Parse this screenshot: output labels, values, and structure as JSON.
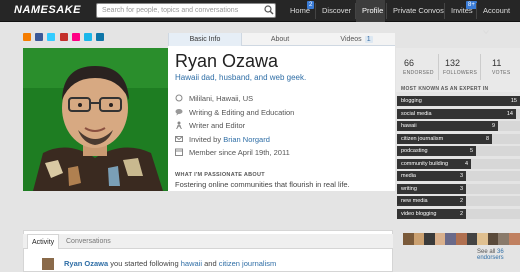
{
  "nav": {
    "logo": "NAMESAKE",
    "search_placeholder": "Search for people, topics and conversations",
    "items": [
      {
        "label": "Home",
        "badge": "2"
      },
      {
        "label": "Discover"
      },
      {
        "label": "Profile"
      },
      {
        "label": "Private Convos"
      },
      {
        "label": "Invites",
        "badge": "8+"
      },
      {
        "label": "Account"
      }
    ]
  },
  "tabs": {
    "basic_info": "Basic Info",
    "about": "About",
    "videos": "Videos",
    "videos_count": "1"
  },
  "profile": {
    "name": "Ryan Ozawa",
    "tagline": "Hawaii dad, husband, and web geek.",
    "location": "Mililani, Hawaii, US",
    "fields": "Writing & Editing and Education",
    "role": "Writer and Editor",
    "invited_prefix": "Invited by",
    "invited_by": "Brian Norgard",
    "member_since": "Member since April 19th, 2011",
    "passion_label": "WHAT I'M PASSIONATE ABOUT",
    "passion": "Fostering online communities that flourish in real life."
  },
  "stats": {
    "endorsed": "66",
    "endorsed_label": "ENDORSED",
    "followers": "132",
    "followers_label": "FOLLOWERS",
    "votes": "11",
    "votes_label": "VOTES"
  },
  "expert": {
    "title": "MOST KNOWN AS AN EXPERT IN",
    "tags": [
      {
        "label": "blogging",
        "count": "15",
        "fraction": 1.0
      },
      {
        "label": "social media",
        "count": "14",
        "fraction": 0.97
      },
      {
        "label": "hawaii",
        "count": "9",
        "fraction": 0.82
      },
      {
        "label": "citizen journalism",
        "count": "8",
        "fraction": 0.77
      },
      {
        "label": "podcasting",
        "count": "5",
        "fraction": 0.64
      },
      {
        "label": "community building",
        "count": "4",
        "fraction": 0.6
      },
      {
        "label": "media",
        "count": "3",
        "fraction": 0.56
      },
      {
        "label": "writing",
        "count": "3",
        "fraction": 0.56
      },
      {
        "label": "new media",
        "count": "2",
        "fraction": 0.56
      },
      {
        "label": "video blogging",
        "count": "2",
        "fraction": 0.56
      }
    ]
  },
  "endorsers": {
    "see_all_prefix": "See all",
    "see_all_link": "36 endorsers"
  },
  "activity": {
    "tab_activity": "Activity",
    "tab_conversations": "Conversations",
    "user": "Ryan Ozawa",
    "text1": "you started following",
    "topic1": "hawaii",
    "conj": "and",
    "topic2": "citizen journalism"
  },
  "colors": {
    "topbar": "#262626",
    "link": "#2f6ea6",
    "badge": "#3a7bd5",
    "tag_bar": "#333333"
  }
}
